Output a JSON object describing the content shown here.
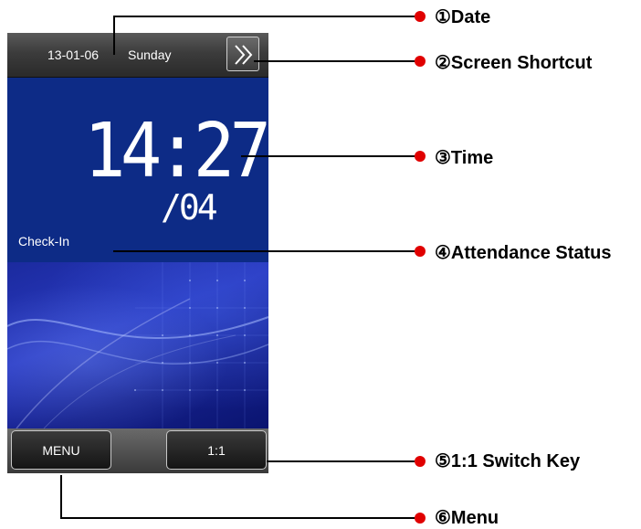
{
  "device": {
    "date": "13-01-06",
    "day": "Sunday",
    "time": "14:27",
    "seconds": "/04",
    "status": "Check-In",
    "menu_label": "MENU",
    "switch_label": "1:1"
  },
  "callouts": [
    {
      "label": "①Date"
    },
    {
      "label": "②Screen Shortcut"
    },
    {
      "label": "③Time"
    },
    {
      "label": "④Attendance Status"
    },
    {
      "label": "⑤1:1 Switch Key"
    },
    {
      "label": "⑥Menu"
    }
  ],
  "colors": {
    "screen_blue": "#0d2b86",
    "callout_dot": "#e00000"
  }
}
